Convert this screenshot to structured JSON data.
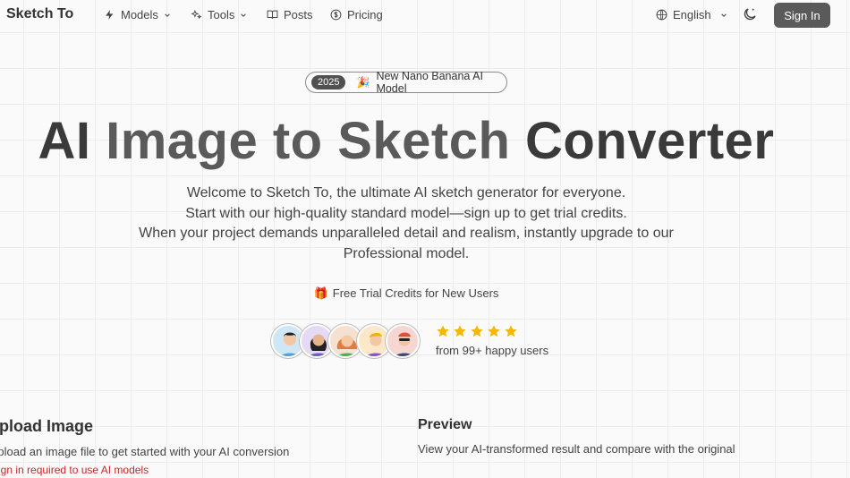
{
  "nav": {
    "brand": "Sketch To",
    "models_label": "Models",
    "tools_label": "Tools",
    "posts_label": "Posts",
    "pricing_label": "Pricing",
    "language": "English",
    "signin_label": "Sign In",
    "icons": [
      "bolt-icon",
      "sparkles-icon",
      "book-icon",
      "dollar-circle-icon",
      "globe-icon",
      "moon-icon",
      "chevron-down-icon"
    ]
  },
  "hero": {
    "badge_year": "2025",
    "badge_text": "New Nano Banana AI Model",
    "title_part1": "AI ",
    "title_part2": "Image to Sketch",
    "title_part3": " Converter",
    "desc_line1": "Welcome to Sketch To, the ultimate AI sketch generator for everyone.",
    "desc_line2": "Start with our high-quality standard model—sign up to get trial credits.",
    "desc_line3": "When your project demands unparalleled detail and realism, instantly upgrade to our Professional model.",
    "trial_text": "Free Trial Credits for New Users",
    "rating_stars": 5,
    "happy_users": "from 99+ happy users"
  },
  "upload": {
    "heading": "Upload Image",
    "description": "Upload an image file to get started with your AI conversion",
    "warning": "Sign in required to use AI models"
  },
  "preview": {
    "heading": "Preview",
    "description": "View your AI-transformed result and compare with the original"
  },
  "colors": {
    "accent": "#5a5a5a",
    "star": "#f5b700",
    "warning": "#c62828"
  }
}
